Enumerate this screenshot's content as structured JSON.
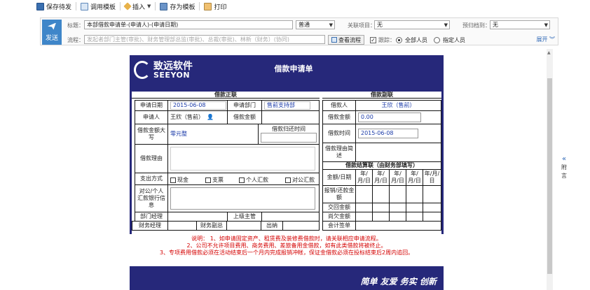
{
  "toolbar": {
    "save_draft": "保存待发",
    "use_template": "调用模板",
    "insert": "插入",
    "save_template": "存为模板",
    "print": "打印"
  },
  "header": {
    "send_label": "发送",
    "title_label": "标题：",
    "title_value": "本部借款申请单-(申请人)-(申请日期)",
    "importance": "普通",
    "related_label": "关联项目：",
    "related_value": "无",
    "archive_label": "预归档到：",
    "archive_value": "无",
    "flow_label": "流程：",
    "flow_placeholder": "发起者部门主管(审批)、财务管理部总监(审批)、总裁(审批)、林新（财务）(协同)",
    "view_flow": "查看流程",
    "track_label": "跟踪：",
    "all_people": "全部人员",
    "specified_people": "指定人员",
    "expand": "展开"
  },
  "form": {
    "logo_cn": "致远软件",
    "logo_en": "SEEYON",
    "title": "借款申请单",
    "section_main": "借款正联",
    "section_sub": "借款副联",
    "apply_date_label": "申请日期",
    "apply_date": "2015-06-08",
    "apply_dept_label": "申请部门",
    "apply_dept": "售前支持部",
    "applicant_label": "申请人",
    "applicant": "王欣（售前）",
    "amount_label": "借款金额",
    "amount_upper_label": "借款金额大写",
    "amount_upper": "零元整",
    "return_time_label": "借款归还时间",
    "reason_label": "借款理由",
    "pay_method_label": "支出方式",
    "pay_cash": "现金",
    "pay_check": "支票",
    "pay_personal": "个人汇款",
    "pay_corporate": "对公汇款",
    "bank_info_label": "对公/个人汇款银行信息",
    "dept_manager_label": "部门经理",
    "superior_label": "上级主管",
    "finance_manager_label": "财务经理",
    "finance_deputy_label": "财务副总",
    "cashier_label": "出纳",
    "sub_borrower_label": "借款人",
    "sub_borrower": "王欣（售前）",
    "sub_amount_label": "借款金额",
    "sub_amount": "0.00",
    "sub_time_label": "借款时间",
    "sub_time": "2015-06-08",
    "sub_reason_label": "借款理由简述",
    "settle_section": "借款结算联（由财务部填写）",
    "settle_amount_date": "金额/日期",
    "date_slot": "年/月/日",
    "reimburse_label": "报销/还款金额",
    "return_amount_label": "交回金额",
    "owed_amount_label": "尚欠金额",
    "accountant_label": "会计签单",
    "notes": [
      "说明： 1、如申请固定资产、租赁费及装修费借款时，请关联相应申请流程。",
      "2、公司不允许项目费用、商务费用、差旅备用金借款，如有此类借款将被终止。",
      "3、专项费用借款必须在活动结束后一个月内完成报销冲帐，保证金借款必须在投标结束后2周内追回。"
    ],
    "slogan": "简单 友爱 务实 创新"
  },
  "side_tab": "附言"
}
